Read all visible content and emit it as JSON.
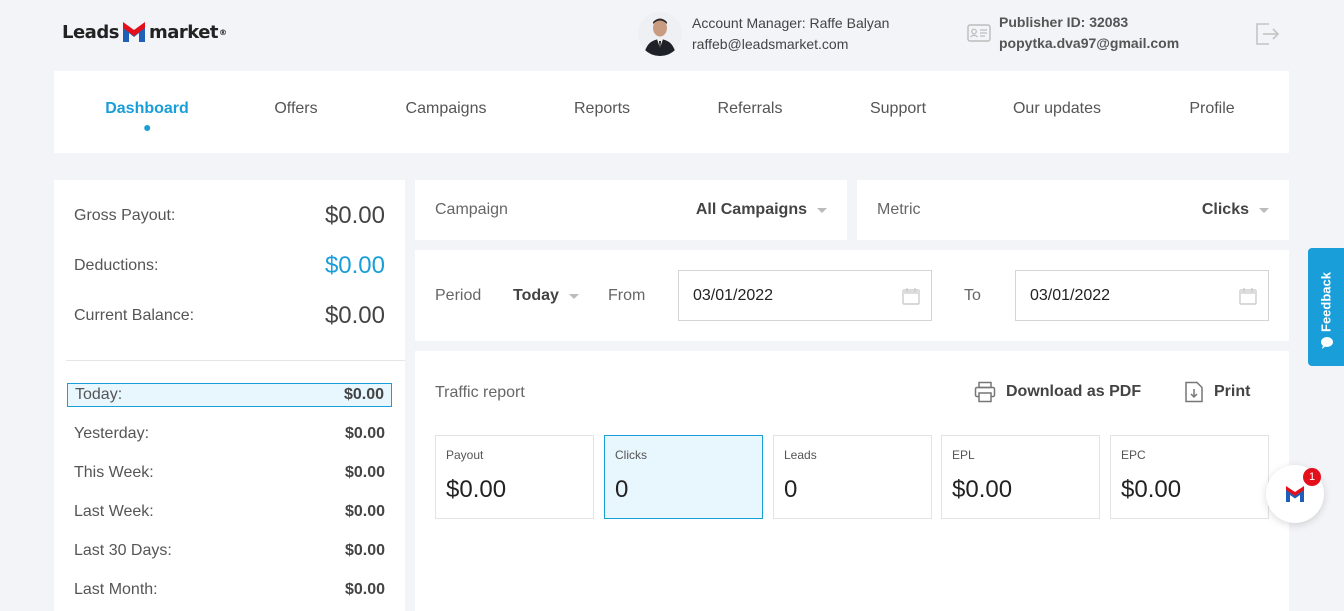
{
  "header": {
    "logo_left": "Leads",
    "logo_right": "market",
    "logo_reg": "®",
    "account_manager": "Account Manager: Raffe Balyan",
    "account_email": "raffeb@leadsmarket.com",
    "publisher_id": "Publisher ID: 32083",
    "publisher_email": "popytka.dva97@gmail.com"
  },
  "nav": {
    "items": [
      {
        "label": "Dashboard",
        "active": true
      },
      {
        "label": "Offers"
      },
      {
        "label": "Campaigns"
      },
      {
        "label": "Reports"
      },
      {
        "label": "Referrals"
      },
      {
        "label": "Support"
      },
      {
        "label": "Our updates"
      },
      {
        "label": "Profile"
      }
    ]
  },
  "balance": {
    "gross_payout_label": "Gross Payout:",
    "gross_payout_value": "$0.00",
    "deductions_label": "Deductions:",
    "deductions_value": "$0.00",
    "current_balance_label": "Current Balance:",
    "current_balance_value": "$0.00"
  },
  "periods": [
    {
      "label": "Today:",
      "value": "$0.00",
      "active": true
    },
    {
      "label": "Yesterday:",
      "value": "$0.00"
    },
    {
      "label": "This Week:",
      "value": "$0.00"
    },
    {
      "label": "Last Week:",
      "value": "$0.00"
    },
    {
      "label": "Last 30 Days:",
      "value": "$0.00"
    },
    {
      "label": "Last Month:",
      "value": "$0.00"
    }
  ],
  "filters": {
    "campaign_label": "Campaign",
    "campaign_value": "All Campaigns",
    "metric_label": "Metric",
    "metric_value": "Clicks",
    "period_label": "Period",
    "period_value": "Today",
    "from_label": "From",
    "from_value": "03/01/2022",
    "to_label": "To",
    "to_value": "03/01/2022"
  },
  "traffic": {
    "title": "Traffic report",
    "download_label": "Download as PDF",
    "print_label": "Print",
    "metrics": [
      {
        "label": "Payout",
        "value": "$0.00"
      },
      {
        "label": "Clicks",
        "value": "0",
        "active": true
      },
      {
        "label": "Leads",
        "value": "0"
      },
      {
        "label": "EPL",
        "value": "$0.00"
      },
      {
        "label": "EPC",
        "value": "$0.00"
      }
    ]
  },
  "feedback": {
    "label": "Feedback"
  },
  "chat": {
    "badge": "1"
  },
  "colors": {
    "accent": "#1a9ed9",
    "brand_red": "#e3101b",
    "brand_blue": "#1f5fb8"
  },
  "icons": [
    "logout-icon",
    "id-card-icon",
    "calendar-icon",
    "printer-icon",
    "download-file-icon",
    "chat-bubble-icon"
  ]
}
